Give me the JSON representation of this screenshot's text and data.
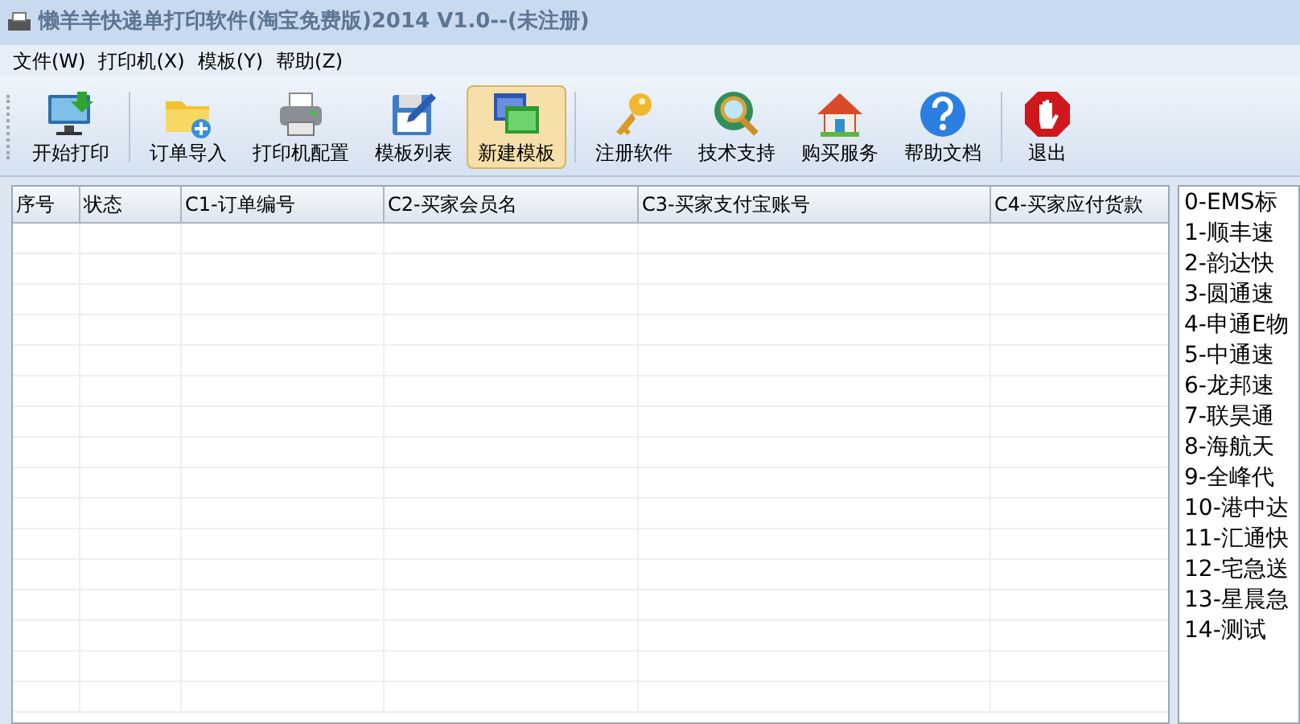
{
  "window": {
    "title": "懒羊羊快递单打印软件(淘宝免费版)2014 V1.0--(未注册)"
  },
  "menu": [
    "文件(W)",
    "打印机(X)",
    "模板(Y)",
    "帮助(Z)"
  ],
  "toolbar": [
    {
      "label": "开始打印",
      "selected": false
    },
    {
      "label": "订单导入",
      "selected": false
    },
    {
      "label": "打印机配置",
      "selected": false
    },
    {
      "label": "模板列表",
      "selected": false
    },
    {
      "label": "新建模板",
      "selected": true
    },
    {
      "label": "注册软件",
      "selected": false
    },
    {
      "label": "技术支持",
      "selected": false
    },
    {
      "label": "购买服务",
      "selected": false
    },
    {
      "label": "帮助文档",
      "selected": false
    },
    {
      "label": "退出",
      "selected": false
    }
  ],
  "table": {
    "columns": [
      "序号",
      "状态",
      "C1-订单编号",
      "C2-买家会员名",
      "C3-买家支付宝账号",
      "C4-买家应付货款"
    ]
  },
  "template_list": [
    "0-EMS标",
    "1-顺丰速",
    "2-韵达快",
    "3-圆通速",
    "4-申通E物",
    "5-中通速",
    "6-龙邦速",
    "7-联昊通",
    "8-海航天",
    "9-全峰代",
    "10-港中达",
    "11-汇通快",
    "12-宅急送",
    "13-星晨急",
    "14-测试"
  ]
}
